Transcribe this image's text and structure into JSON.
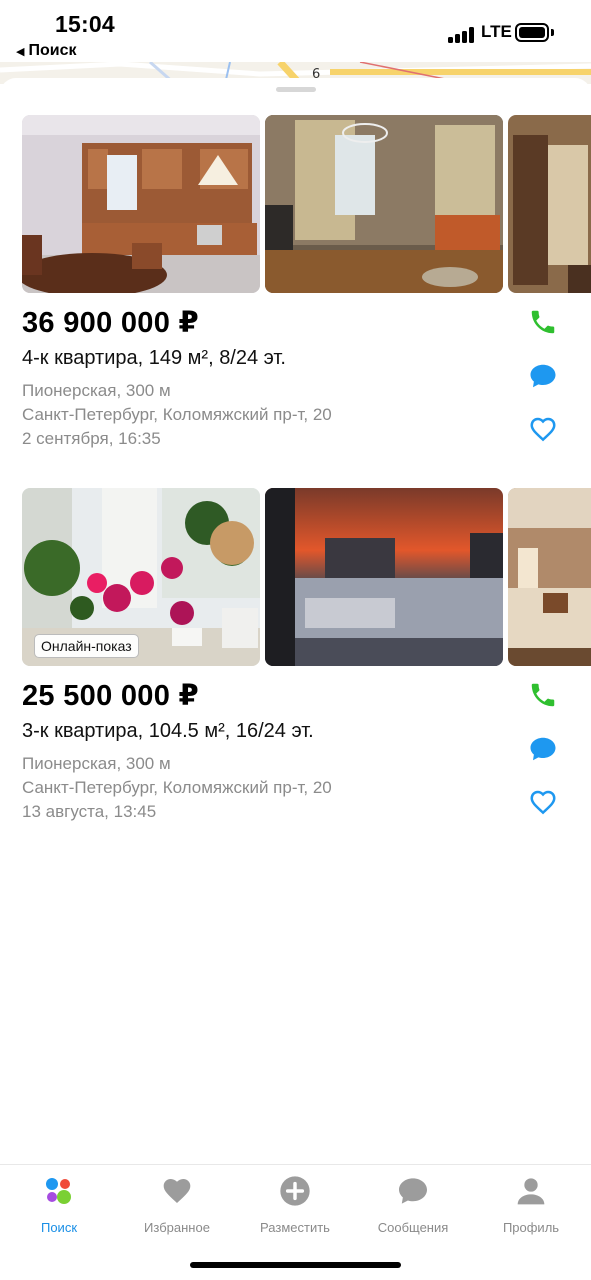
{
  "status_bar": {
    "time": "15:04",
    "back_label": "Поиск",
    "network": "LTE"
  },
  "listings": [
    {
      "price": "36 900 000 ₽",
      "title": "4-к квартира, 149 м², 8/24 эт.",
      "metro": "Пионерская,  300 м",
      "address": "Санкт-Петербург, Коломяжский пр-т, 20",
      "date": "2 сентября, 16:35",
      "badge": null
    },
    {
      "price": "25 500 000 ₽",
      "title": "3-к квартира, 104.5 м², 16/24 эт.",
      "metro": "Пионерская,  300 м",
      "address": "Санкт-Петербург, Коломяжский пр-т, 20",
      "date": "13 августа, 13:45",
      "badge": "Онлайн-показ"
    }
  ],
  "actions": {
    "phone_icon": "phone-icon",
    "chat_icon": "chat-icon",
    "favorite_icon": "heart-outline-icon"
  },
  "tab_bar": {
    "tabs": [
      {
        "label": "Поиск",
        "icon": "search-dots-icon",
        "active": true
      },
      {
        "label": "Избранное",
        "icon": "heart-icon",
        "active": false
      },
      {
        "label": "Разместить",
        "icon": "plus-circle-icon",
        "active": false
      },
      {
        "label": "Сообщения",
        "icon": "chat-bubble-icon",
        "active": false
      },
      {
        "label": "Профиль",
        "icon": "person-icon",
        "active": false
      }
    ]
  },
  "colors": {
    "accent_blue": "#1a8fe6",
    "phone_green": "#2fbf2f",
    "chat_blue": "#1e98f0",
    "meta_gray": "#8b8b8b",
    "tab_gray": "#8a8a8a"
  }
}
